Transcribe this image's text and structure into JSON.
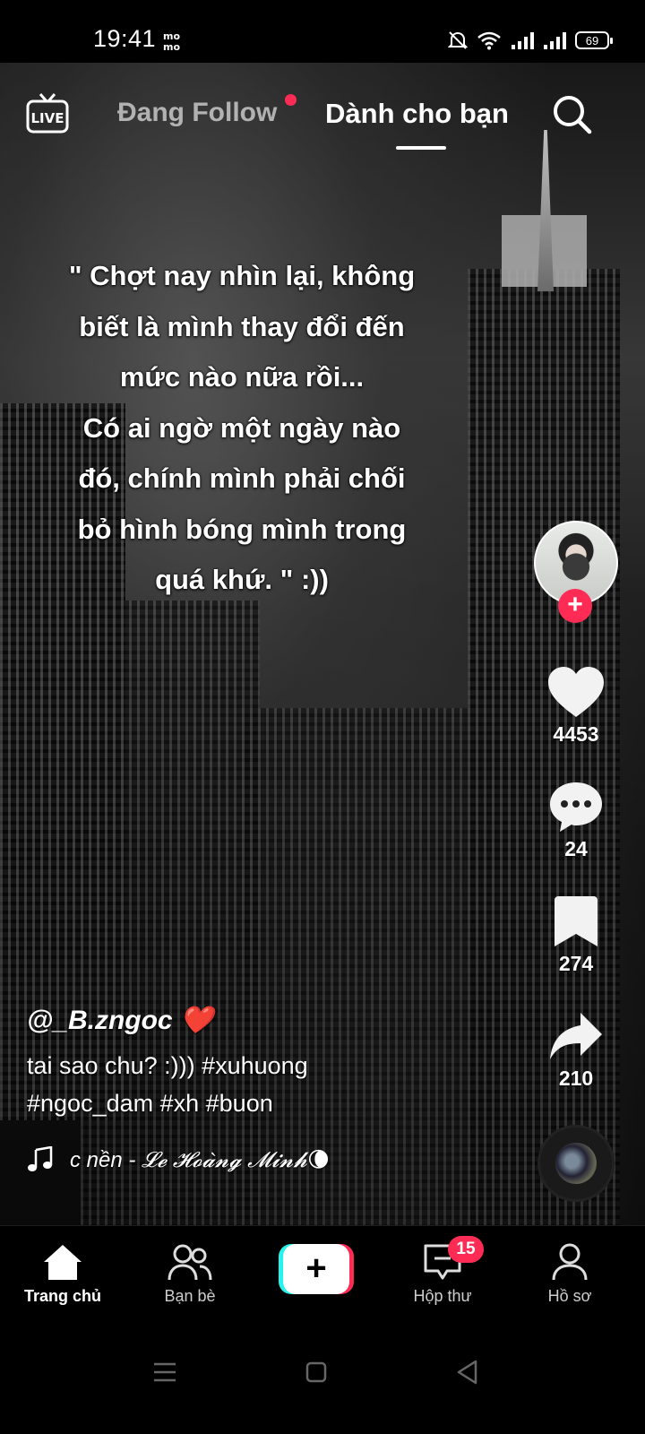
{
  "status_bar": {
    "time": "19:41",
    "battery": "69"
  },
  "top_nav": {
    "live_label": "LIVE",
    "following_label": "Đang Follow",
    "for_you_label": "Dành cho bạn"
  },
  "video": {
    "overlay_text": "\" Chợt nay nhìn lại, không\nbiết là mình thay đổi đến\nmức nào nữa rồi...\nCó ai ngờ một ngày nào\nđó, chính mình phải chối\nbỏ hình bóng mình trong\nquá khứ. \" :))"
  },
  "actions": {
    "likes": "4453",
    "comments": "24",
    "saves": "274",
    "shares": "210"
  },
  "post": {
    "username": "@_B.zngoc ❤️",
    "description": "tai sao chu? :))) #xuhuong #ngoc_dam #xh #buon",
    "music": "c nền - 𝓛𝓮 𝓗𝓸𝓪̀𝓷𝓰 𝓜𝓲𝓷𝓱🌘"
  },
  "bottom_nav": {
    "home": "Trang chủ",
    "friends": "Bạn bè",
    "inbox": "Hộp thư",
    "inbox_badge": "15",
    "profile": "Hồ sơ"
  },
  "colors": {
    "accent": "#fe2c55",
    "cyan": "#25f4ee"
  }
}
